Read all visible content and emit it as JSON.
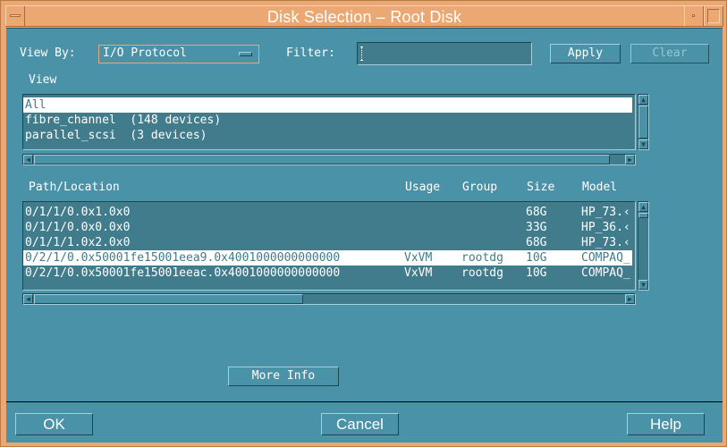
{
  "window": {
    "title": "Disk Selection – Root Disk"
  },
  "toolbar": {
    "view_by_label": "View By:",
    "view_by_value": "I/O Protocol",
    "filter_label": "Filter:",
    "filter_value": "",
    "apply_label": "Apply",
    "clear_label": "Clear"
  },
  "view_section": {
    "label": "View",
    "items": [
      {
        "text": "All",
        "selected": true
      },
      {
        "text": "fibre_channel  (148 devices)",
        "selected": false
      },
      {
        "text": "parallel_scsi  (3 devices)",
        "selected": false
      }
    ]
  },
  "disk_table": {
    "columns": [
      "Path/Location",
      "Usage",
      "Group",
      "Size",
      "Model"
    ],
    "rows": [
      {
        "path": "0/1/1/0.0x1.0x0",
        "usage": "",
        "group": "",
        "size": "68G",
        "model": "HP_73.‹",
        "selected": false
      },
      {
        "path": "0/1/1/0.0x0.0x0",
        "usage": "",
        "group": "",
        "size": "33G",
        "model": "HP_36.‹",
        "selected": false
      },
      {
        "path": "0/1/1/1.0x2.0x0",
        "usage": "",
        "group": "",
        "size": "68G",
        "model": "HP_73.‹",
        "selected": false
      },
      {
        "path": "0/2/1/0.0x50001fe15001eea9.0x4001000000000000",
        "usage": "VxVM",
        "group": "rootdg",
        "size": "10G",
        "model": "COMPAQ_",
        "selected": true
      },
      {
        "path": "0/2/1/0.0x50001fe15001eeac.0x4001000000000000",
        "usage": "VxVM",
        "group": "rootdg",
        "size": "10G",
        "model": "COMPAQ_",
        "selected": false
      }
    ]
  },
  "more_info_label": "More Info",
  "footer": {
    "ok_label": "OK",
    "cancel_label": "Cancel",
    "help_label": "Help"
  },
  "colors": {
    "frame": "#eba872",
    "background": "#4a92a7",
    "list_background": "#407c8c",
    "selection": "#ffffff"
  }
}
